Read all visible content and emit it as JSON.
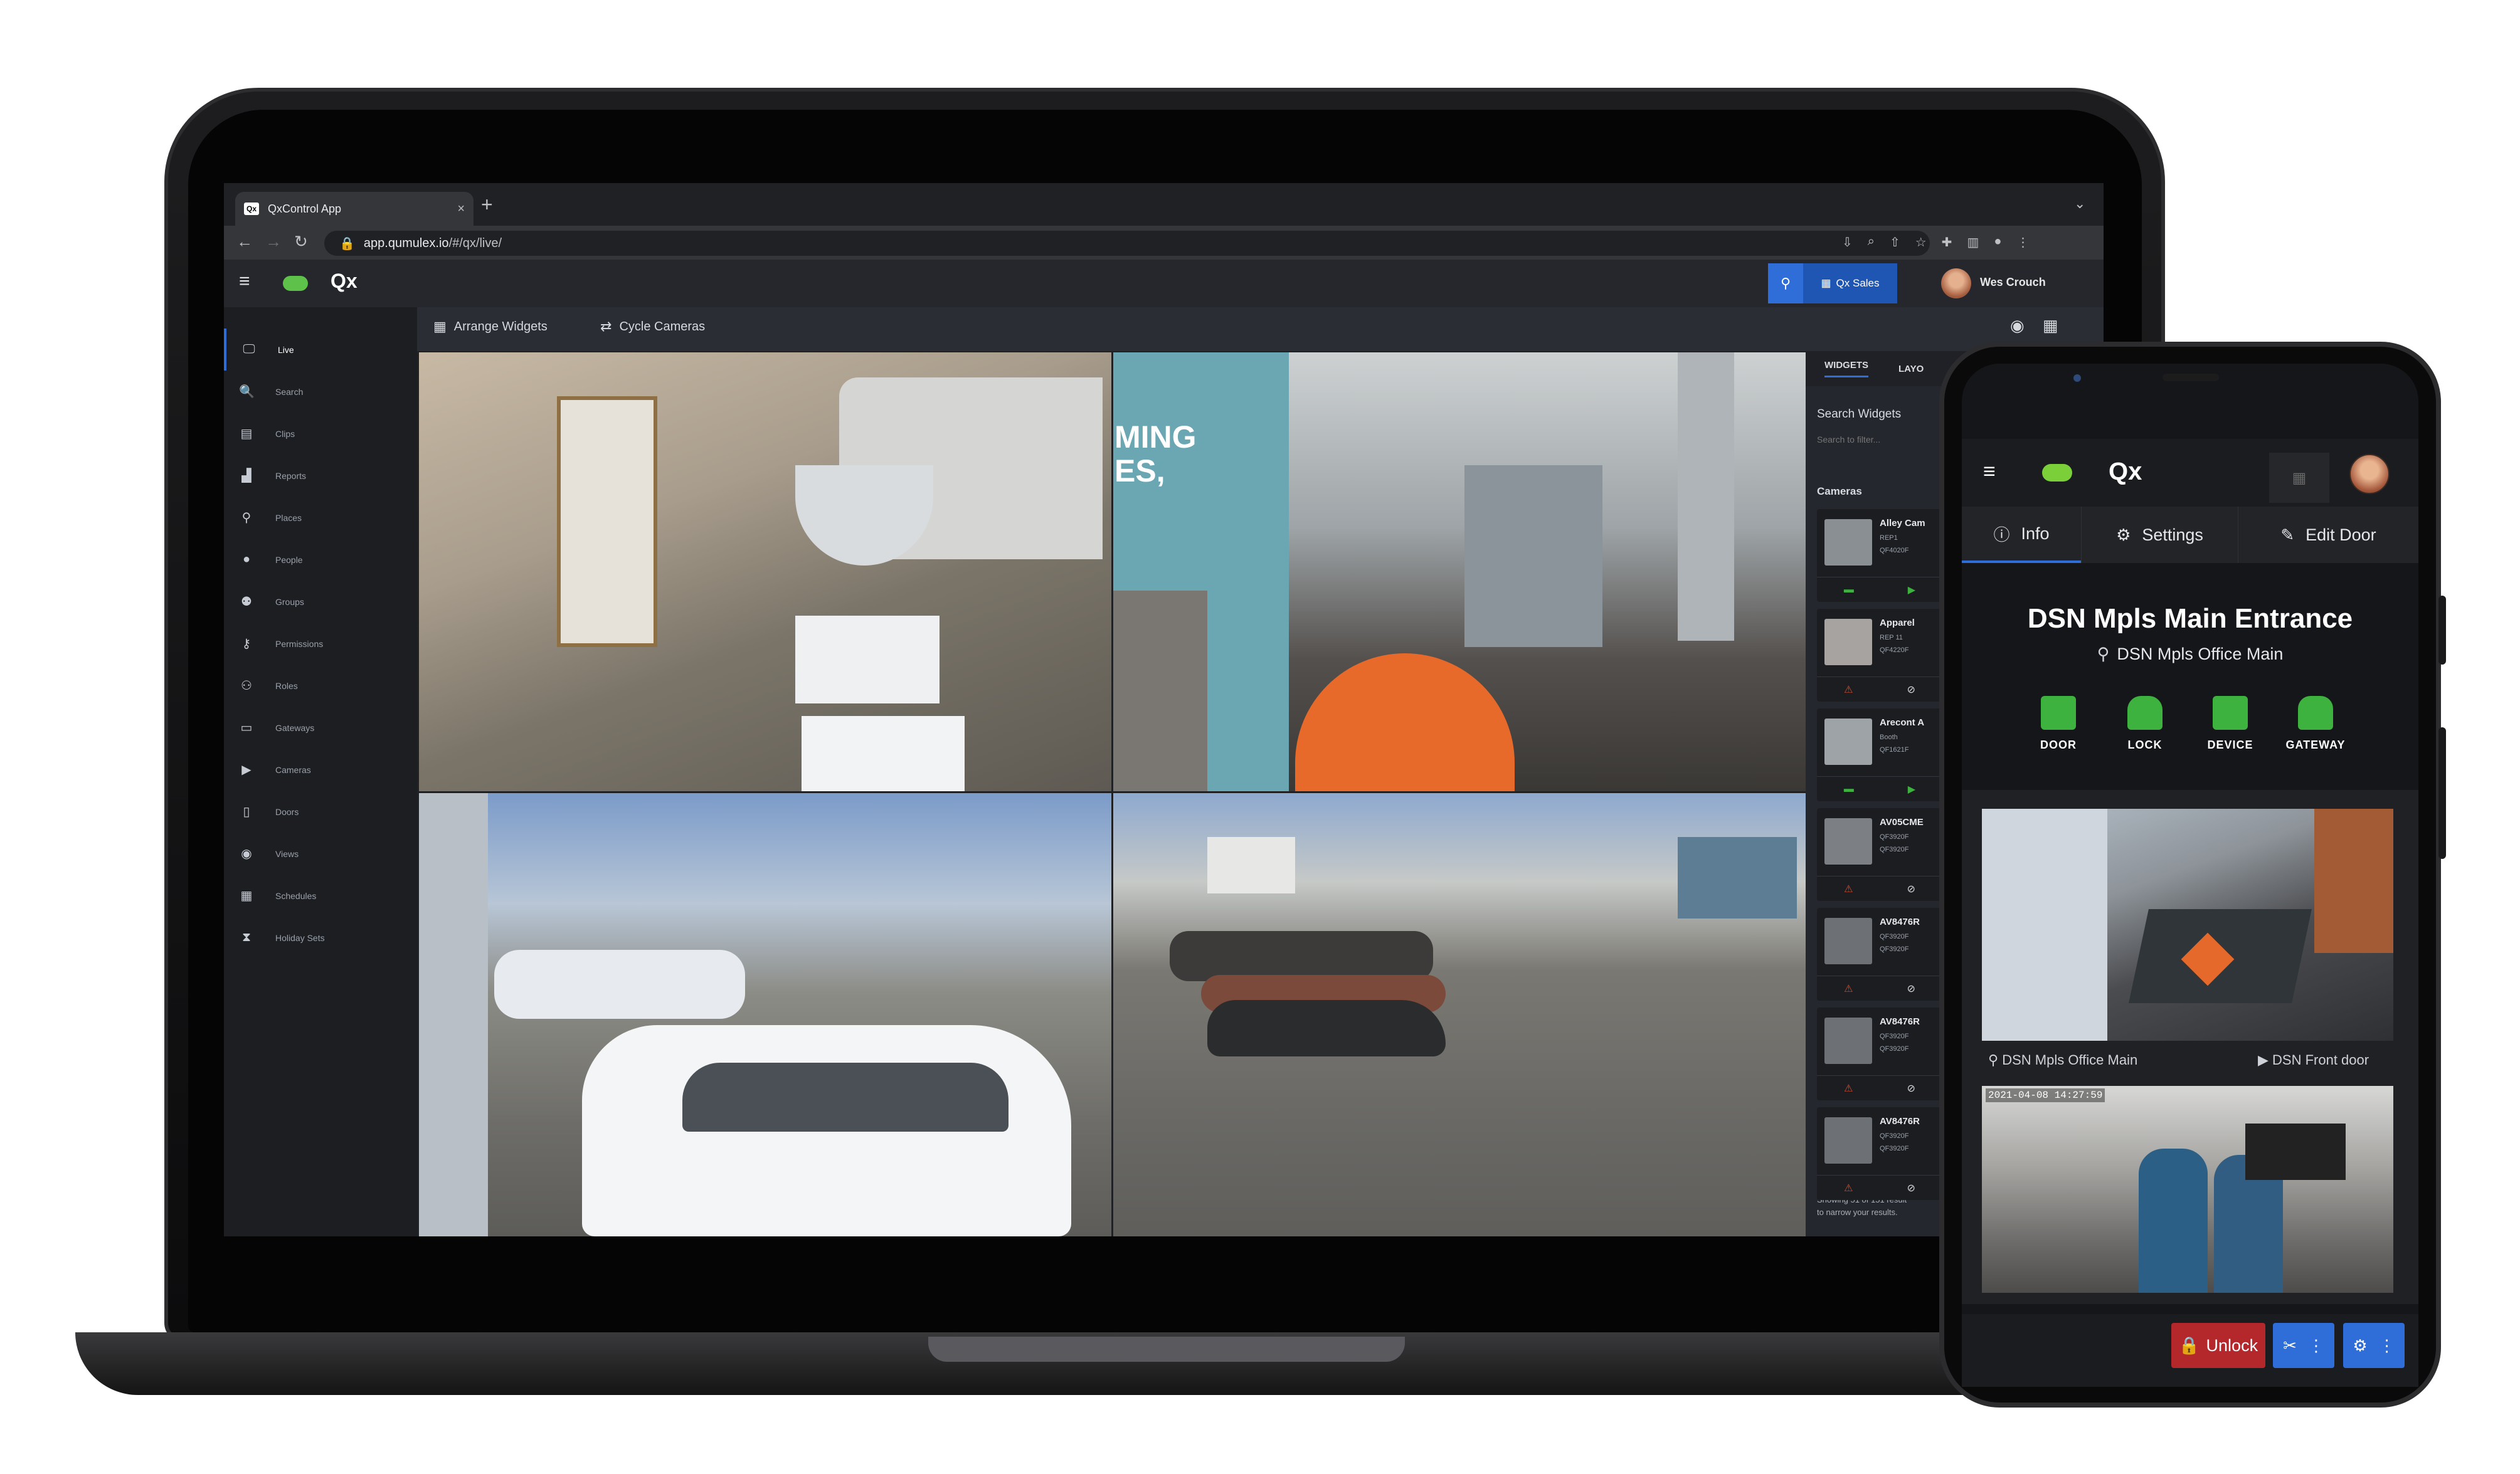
{
  "browser": {
    "tab_title": "QxControl App",
    "tab_favicon": "Qx",
    "tab_close": "×",
    "new_tab": "+",
    "url_host": "app.qumulex.io",
    "url_path": "/#/qx/live/"
  },
  "app": {
    "logo": "Qx",
    "site_button": "Qx Sales",
    "user_name": "Wes Crouch"
  },
  "sidebar": {
    "items": [
      {
        "label": "Live",
        "icon": "monitor-icon",
        "glyph": "🖵"
      },
      {
        "label": "Search",
        "icon": "search-icon",
        "glyph": "🔍"
      },
      {
        "label": "Clips",
        "icon": "clip-icon",
        "glyph": "▤"
      },
      {
        "label": "Reports",
        "icon": "chart-icon",
        "glyph": "▟"
      },
      {
        "label": "Places",
        "icon": "map-pin-icon",
        "glyph": "⚲"
      },
      {
        "label": "People",
        "icon": "person-icon",
        "glyph": "●"
      },
      {
        "label": "Groups",
        "icon": "group-icon",
        "glyph": "⚉"
      },
      {
        "label": "Permissions",
        "icon": "key-icon",
        "glyph": "⚷"
      },
      {
        "label": "Roles",
        "icon": "roles-icon",
        "glyph": "⚇"
      },
      {
        "label": "Gateways",
        "icon": "gateway-icon",
        "glyph": "▭"
      },
      {
        "label": "Cameras",
        "icon": "camera-icon",
        "glyph": "▶"
      },
      {
        "label": "Doors",
        "icon": "door-icon",
        "glyph": "▯"
      },
      {
        "label": "Views",
        "icon": "eye-icon",
        "glyph": "◉"
      },
      {
        "label": "Schedules",
        "icon": "calendar-icon",
        "glyph": "▦"
      },
      {
        "label": "Holiday Sets",
        "icon": "hourglass-icon",
        "glyph": "⧗"
      }
    ]
  },
  "toolbar": {
    "arrange_label": "Arrange Widgets",
    "cycle_label": "Cycle Cameras"
  },
  "widgets_panel": {
    "tabs": [
      "WIDGETS",
      "LAYO"
    ],
    "search_label": "Search Widgets",
    "search_placeholder": "Search to filter...",
    "cameras_heading": "Cameras",
    "cameras": [
      {
        "name": "Alley Cam",
        "line1": "REP1",
        "line2": "QF4020F",
        "status": "online"
      },
      {
        "name": "Apparel",
        "line1": "REP 11",
        "line2": "QF4220F",
        "status": "offline"
      },
      {
        "name": "Arecont A",
        "line1": "Booth",
        "line2": "QF1621F",
        "status": "online"
      },
      {
        "name": "AV05CME",
        "line1": "QF3920F",
        "line2": "QF3920F",
        "status": "offline"
      },
      {
        "name": "AV8476R",
        "line1": "QF3920F",
        "line2": "QF3920F",
        "status": "offline"
      },
      {
        "name": "AV8476R",
        "line1": "QF3920F",
        "line2": "QF3920F",
        "status": "offline"
      },
      {
        "name": "AV8476R",
        "line1": "QF3920F",
        "line2": "QF3920F",
        "status": "offline"
      }
    ],
    "showing_line1": "Showing 51 of 151 result",
    "showing_line2": "to narrow your results."
  },
  "feeds": {
    "wall_text_1": "MING",
    "wall_text_2": "ES,"
  },
  "phone": {
    "logo": "Qx",
    "tabs": [
      {
        "label": "Info",
        "icon": "info-icon"
      },
      {
        "label": "Settings",
        "icon": "sitemap-icon"
      },
      {
        "label": "Edit Door",
        "icon": "edit-icon"
      }
    ],
    "door_title": "DSN Mpls Main Entrance",
    "door_location": "DSN Mpls Office Main",
    "status_icons": [
      {
        "label": "DOOR",
        "icon": "door-icon"
      },
      {
        "label": "LOCK",
        "icon": "lock-icon"
      },
      {
        "label": "DEVICE",
        "icon": "device-icon"
      },
      {
        "label": "GATEWAY",
        "icon": "gateway-icon"
      }
    ],
    "feed_caption_left": "DSN Mpls Office Main",
    "feed_caption_right": "DSN Front door",
    "feed2_timestamp": "2021-04-08 14:27:59",
    "unlock_label": "Unlock"
  },
  "colors": {
    "accent_blue": "#2f6ed8",
    "cloud_green": "#5ec24a",
    "status_green": "#3db23e",
    "offline_red": "#d04a2a",
    "unlock_red": "#b4282b"
  }
}
